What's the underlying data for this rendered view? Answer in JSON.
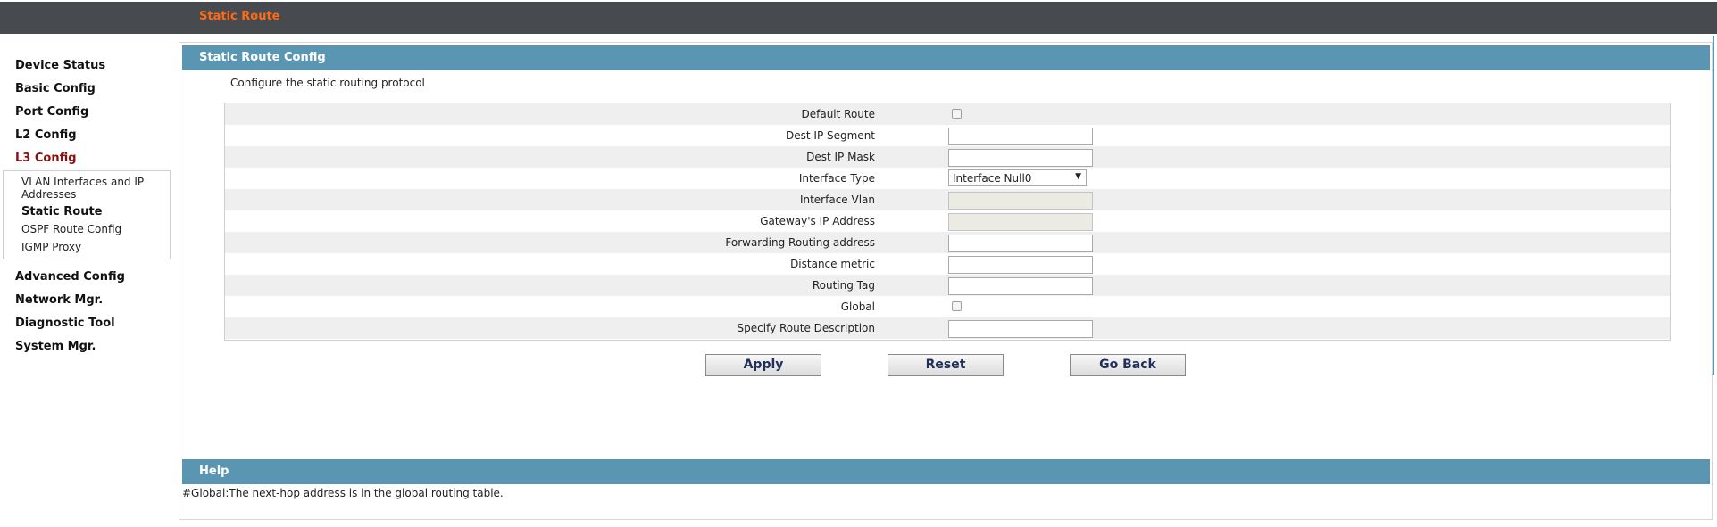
{
  "header": {
    "title": "Static Route"
  },
  "sidebar": {
    "items": [
      {
        "label": "Device Status"
      },
      {
        "label": "Basic Config"
      },
      {
        "label": "Port Config"
      },
      {
        "label": "L2 Config"
      },
      {
        "label": "L3 Config"
      },
      {
        "label": "Advanced Config"
      },
      {
        "label": "Network Mgr."
      },
      {
        "label": "Diagnostic Tool"
      },
      {
        "label": "System Mgr."
      }
    ],
    "active": "L3 Config",
    "submenu": [
      {
        "label": "VLAN Interfaces and IP Addresses"
      },
      {
        "label": "Static Route"
      },
      {
        "label": "OSPF Route Config"
      },
      {
        "label": "IGMP Proxy"
      }
    ],
    "submenu_active": "Static Route"
  },
  "config": {
    "title": "Static Route Config",
    "description": "Configure the static routing protocol",
    "fields": [
      {
        "label": "Default Route",
        "type": "checkbox",
        "checked": false
      },
      {
        "label": "Dest IP Segment",
        "type": "text",
        "value": ""
      },
      {
        "label": "Dest IP Mask",
        "type": "text",
        "value": ""
      },
      {
        "label": "Interface Type",
        "type": "select",
        "value": "Interface Null0"
      },
      {
        "label": "Interface Vlan",
        "type": "text",
        "value": "",
        "disabled": true
      },
      {
        "label": "Gateway's IP Address",
        "type": "text",
        "value": "",
        "disabled": true
      },
      {
        "label": "Forwarding Routing address",
        "type": "text",
        "value": ""
      },
      {
        "label": "Distance metric",
        "type": "text",
        "value": ""
      },
      {
        "label": "Routing Tag",
        "type": "text",
        "value": ""
      },
      {
        "label": "Global",
        "type": "checkbox",
        "checked": false
      },
      {
        "label": "Specify Route Description",
        "type": "text",
        "value": ""
      }
    ],
    "buttons": {
      "apply": "Apply",
      "reset": "Reset",
      "back": "Go Back"
    }
  },
  "help": {
    "title": "Help",
    "text": "#Global:The next-hop address is in the global routing table."
  },
  "colors": {
    "topbar": "#474b4f",
    "title_accent": "#ff6a13",
    "section_header": "#5a96b2",
    "active_nav": "#8b0f0f"
  }
}
